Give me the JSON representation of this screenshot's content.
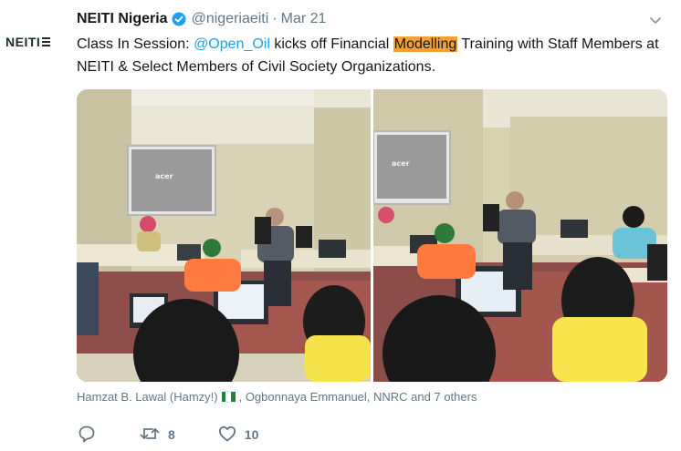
{
  "account": {
    "avatar_text": "NEITI",
    "name": "NEITI Nigeria",
    "handle": "@nigeriaeiti",
    "separator": "·",
    "date": "Mar 21",
    "verified_icon": "verified-badge-icon"
  },
  "tweet": {
    "text_part1": "Class In Session: ",
    "mention": "@Open_Oil",
    "text_part2": " kicks off Financial ",
    "highlight": "Modelling",
    "text_part3": " Training with Staff Members at NEITI & Select Members of Civil Society Organizations.",
    "mention_color": "#1da1f2",
    "highlight_color": "#f5a030"
  },
  "media": {
    "left_photo_icon": "classroom-photo",
    "right_photo_icon": "classroom-photo",
    "projector_logo": "acer"
  },
  "likers": {
    "part1": "Hamzat B. Lawal (Hamzy!)",
    "part2": ", Ogbonnaya Emmanuel, NNRC and 7 others",
    "flag_icon": "nigeria-flag-icon"
  },
  "actions": {
    "reply_icon": "reply-icon",
    "retweet_icon": "retweet-icon",
    "retweet_count": "8",
    "like_icon": "heart-icon",
    "like_count": "10"
  },
  "colors": {
    "text": "#14171a",
    "muted": "#657786",
    "accent": "#1da1f2"
  }
}
